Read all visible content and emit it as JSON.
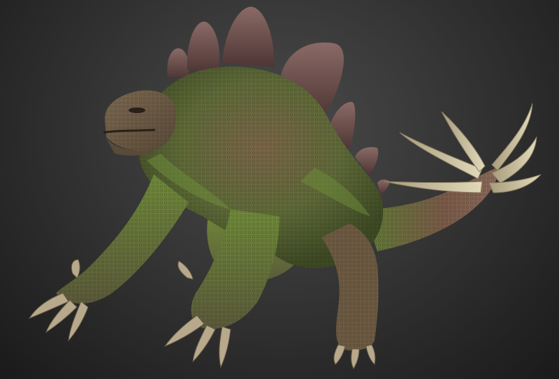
{
  "scene": {
    "subject": "stegosaur-creature-sculpt",
    "colors": {
      "background_center": "#4a4a4a",
      "background_edge": "#1a1a1a",
      "skin_green": "#5f7a33",
      "skin_brown": "#6f5a43",
      "plates": "#6b4a48",
      "tail_spikes": "#d6ccab",
      "claws": "#b8a98c"
    }
  }
}
